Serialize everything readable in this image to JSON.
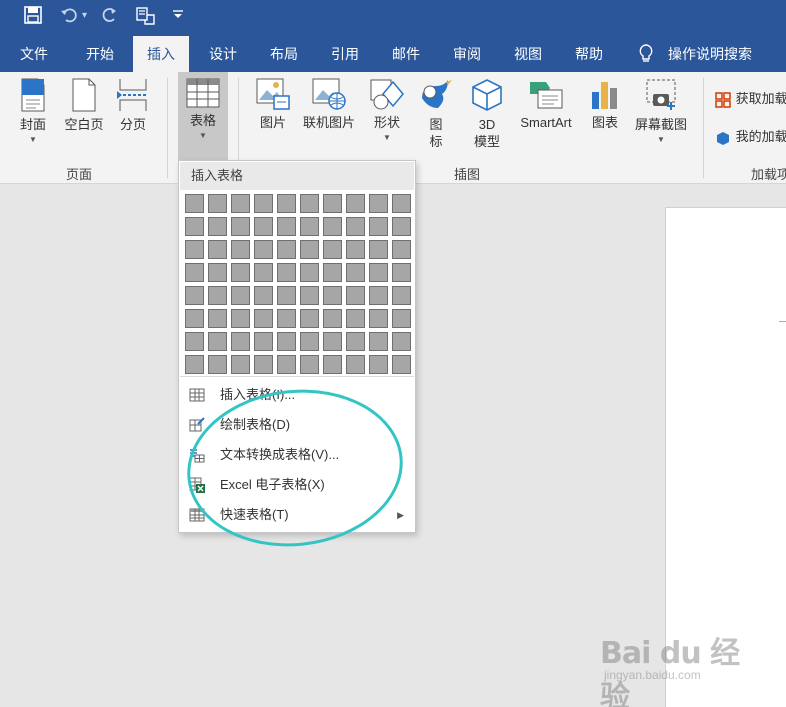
{
  "quick_access": {
    "save_icon": "save-icon",
    "undo_icon": "undo-icon",
    "redo_icon": "redo-icon",
    "touch_icon": "touch-mode-icon",
    "customize_icon": "customize-icon",
    "separator": "▾"
  },
  "tabs": [
    {
      "label": "文件"
    },
    {
      "label": "开始"
    },
    {
      "label": "插入"
    },
    {
      "label": "设计"
    },
    {
      "label": "布局"
    },
    {
      "label": "引用"
    },
    {
      "label": "邮件"
    },
    {
      "label": "审阅"
    },
    {
      "label": "视图"
    },
    {
      "label": "帮助"
    },
    {
      "label": "操作说明搜索"
    }
  ],
  "ribbon": {
    "pages_group": {
      "label": "页面",
      "cover": "封面",
      "blank": "空白页",
      "break": "分页"
    },
    "tables_group": {
      "table": "表格"
    },
    "illustrations_group": {
      "label": "插图",
      "picture": "图片",
      "online_picture": "联机图片",
      "shapes": "形状",
      "icons_line1": "图",
      "icons_line2": "标",
      "model_line1": "3D",
      "model_line2": "模型",
      "smartart": "SmartArt",
      "chart": "图表",
      "screenshot": "屏幕截图"
    },
    "addins_group": {
      "label": "加载项",
      "get": "获取加载",
      "mine": "我的加载"
    }
  },
  "dropdown": {
    "header": "插入表格",
    "items": [
      {
        "label": "插入表格(I)...",
        "icon": "table-grid-icon"
      },
      {
        "label": "绘制表格(D)",
        "icon": "draw-table-icon"
      },
      {
        "label": "文本转换成表格(V)...",
        "icon": "convert-text-icon"
      },
      {
        "label": "Excel 电子表格(X)",
        "icon": "excel-icon"
      },
      {
        "label": "快速表格(T)",
        "icon": "quick-table-icon"
      }
    ]
  },
  "watermark": {
    "main": "Bai du 经验",
    "sub": "jingyan.baidu.com"
  },
  "colors": {
    "brand": "#2b579a",
    "highlight_circle": "#33c4c4"
  }
}
